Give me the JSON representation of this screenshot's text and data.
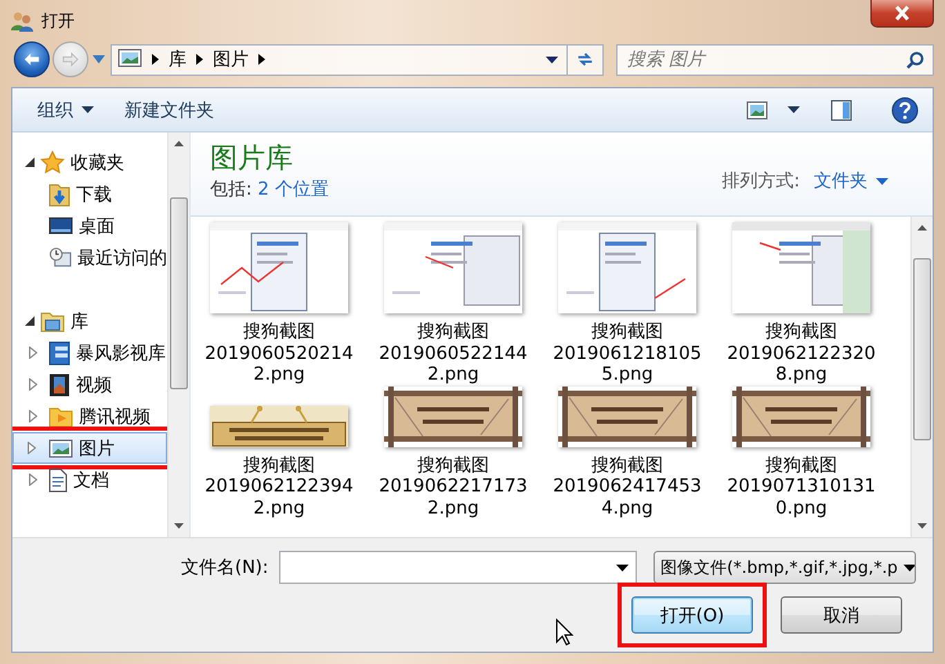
{
  "window": {
    "title": "打开"
  },
  "address": {
    "path": [
      "库",
      "图片"
    ]
  },
  "search": {
    "placeholder": "搜索 图片"
  },
  "toolbar": {
    "organize": "组织",
    "new_folder": "新建文件夹"
  },
  "nav": {
    "groups": [
      {
        "label": "收藏夹",
        "kind": "favorites",
        "expanded": true,
        "children": [
          {
            "label": "下载",
            "kind": "download",
            "selected": false
          },
          {
            "label": "桌面",
            "kind": "desktop",
            "selected": false
          },
          {
            "label": "最近访问的",
            "kind": "recent",
            "selected": false
          }
        ]
      },
      {
        "label": "库",
        "kind": "library",
        "expanded": true,
        "children": [
          {
            "label": "暴风影视库",
            "kind": "videolib",
            "selected": false,
            "expanded": false
          },
          {
            "label": "视频",
            "kind": "video",
            "selected": false,
            "expanded": false
          },
          {
            "label": "腾讯视频",
            "kind": "tencent",
            "selected": false,
            "expanded": false
          },
          {
            "label": "图片",
            "kind": "pictures",
            "selected": true,
            "expanded": false,
            "annotated": true
          },
          {
            "label": "文档",
            "kind": "documents",
            "selected": false,
            "expanded": false
          }
        ]
      }
    ]
  },
  "content": {
    "title": "图片库",
    "includes_label": "包括:",
    "includes_link": "2 个位置",
    "sort_label": "排列方式:",
    "sort_value": "文件夹",
    "files": [
      {
        "kind": "screenshot",
        "lines": [
          "搜狗截图",
          "2019060520214",
          "2.png"
        ]
      },
      {
        "kind": "screenshot",
        "lines": [
          "搜狗截图",
          "2019060522144",
          "2.png"
        ]
      },
      {
        "kind": "screenshot",
        "lines": [
          "搜狗截图",
          "2019061218105",
          "5.png"
        ]
      },
      {
        "kind": "screenshot",
        "lines": [
          "搜狗截图",
          "2019062122320",
          "8.png"
        ]
      },
      {
        "kind": "banner",
        "lines": [
          "搜狗截图",
          "2019062122394",
          "2.png"
        ]
      },
      {
        "kind": "banner",
        "lines": [
          "搜狗截图",
          "2019062217173",
          "2.png"
        ]
      },
      {
        "kind": "banner",
        "lines": [
          "搜狗截图",
          "2019062417453",
          "4.png"
        ]
      },
      {
        "kind": "banner",
        "lines": [
          "搜狗截图",
          "2019071310131",
          "0.png"
        ]
      }
    ]
  },
  "footer": {
    "filename_label": "文件名(N):",
    "filetype": "图像文件(*.bmp,*.gif,*.jpg,*.p",
    "buttons": [
      {
        "label": "打开(O)",
        "kind": "primary",
        "annotated": true
      },
      {
        "label": "取消",
        "kind": "cancel",
        "annotated": false
      }
    ]
  }
}
